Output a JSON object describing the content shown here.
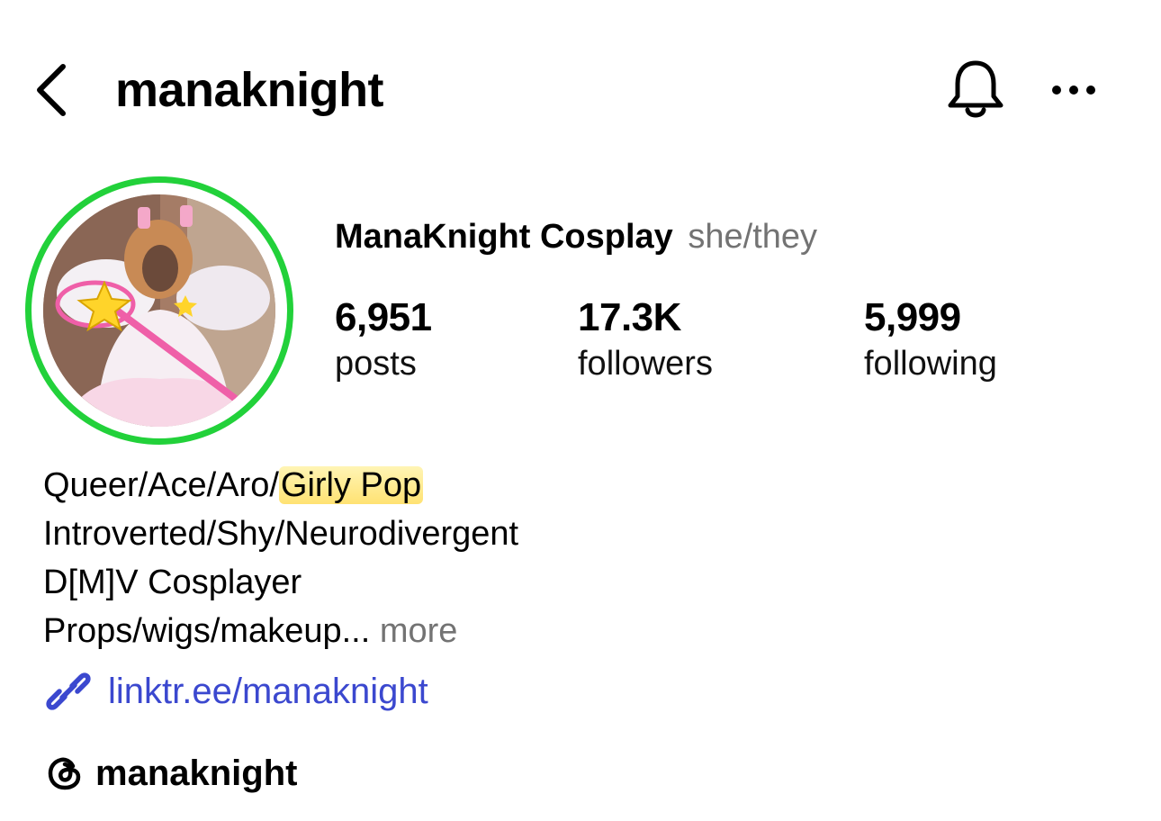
{
  "header": {
    "username": "manaknight",
    "icons": {
      "back": "chevron-left-icon",
      "bell": "bell-icon",
      "more": "more-horizontal-icon"
    }
  },
  "profile": {
    "display_name": "ManaKnight Cosplay",
    "pronouns": "she/they",
    "avatar_ring_color": "#22d13a"
  },
  "stats": {
    "posts": {
      "value": "6,951",
      "label": "posts"
    },
    "followers": {
      "value": "17.3K",
      "label": "followers"
    },
    "following": {
      "value": "5,999",
      "label": "following"
    }
  },
  "bio": {
    "line1_a": "Queer/Ace/Aro/",
    "line1_highlight": "Girly Pop",
    "line2": "Introverted/Shy/Neurodivergent",
    "line3": "D[M]V Cosplayer",
    "line4": "Props/wigs/makeup...",
    "more": "more",
    "highlight_color": "#ffdd5a"
  },
  "link": {
    "text": "linktr.ee/manaknight",
    "icon": "link-icon",
    "color": "#3b48cf"
  },
  "threads": {
    "handle": "manaknight",
    "icon": "threads-icon"
  }
}
